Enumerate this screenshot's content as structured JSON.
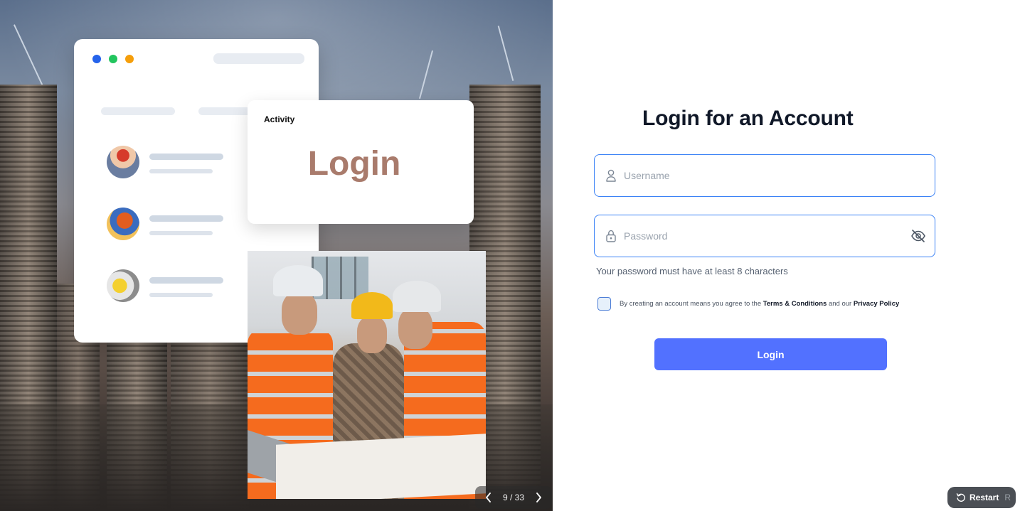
{
  "hero": {
    "activity_card": {
      "title": "Activity",
      "headline": "Login"
    },
    "pager": {
      "current": 9,
      "total": 33,
      "label": "9 / 33",
      "prev_icon": "chevron-left-icon",
      "next_icon": "chevron-right-icon"
    }
  },
  "form": {
    "title": "Login for an Account",
    "username": {
      "placeholder": "Username",
      "value": "",
      "icon": "user-icon"
    },
    "password": {
      "placeholder": "Password",
      "value": "",
      "icon": "lock-icon",
      "toggle_icon": "eye-off-icon"
    },
    "password_hint": "Your password must have at least 8 characters",
    "terms": {
      "checked": false,
      "prefix": "By creating an account means you agree to the",
      "terms_link": "Terms  & Conditions",
      "middle": "and our",
      "privacy_link": "Privacy Policy"
    },
    "submit_label": "Login"
  },
  "restart": {
    "label": "Restart",
    "shortcut": "R",
    "icon": "restart-icon"
  },
  "colors": {
    "primary": "#5271ff",
    "field_border": "#3b82f6",
    "title": "#101828",
    "activity_headline": "#a97b6c"
  }
}
